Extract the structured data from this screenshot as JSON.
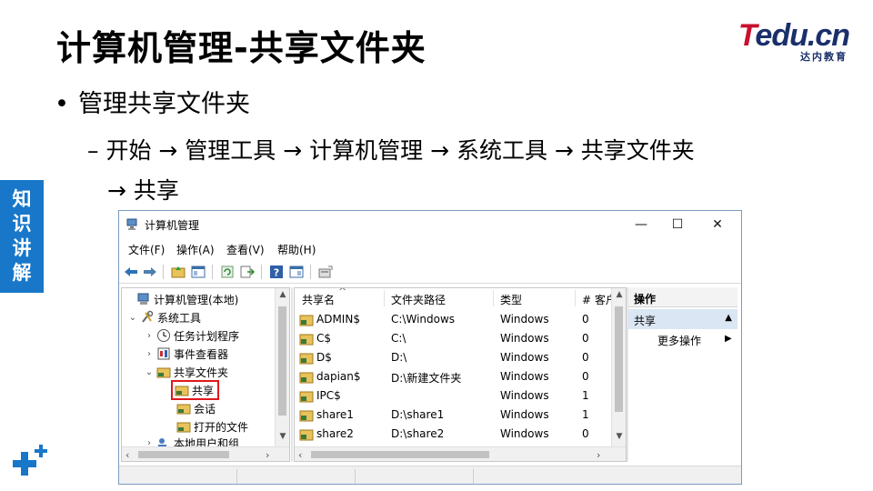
{
  "slide": {
    "title": "计算机管理-共享文件夹",
    "bullet": "管理共享文件夹",
    "path_line1": "– 开始 → 管理工具 → 计算机管理 → 系统工具 → 共享文件夹",
    "path_line2": "→ 共享",
    "side_tab": [
      "知",
      "识",
      "讲",
      "解"
    ]
  },
  "logo": {
    "brand_t": "T",
    "brand_rest": "edu.cn",
    "subtitle": "达内教育",
    "colors": {
      "red": "#c8102e",
      "navy": "#1a2f6b"
    }
  },
  "window": {
    "title": "计算机管理",
    "controls": {
      "minimize": "—",
      "maximize": "☐",
      "close": "✕"
    },
    "menu": [
      "文件(F)",
      "操作(A)",
      "查看(V)",
      "帮助(H)"
    ],
    "toolbar_icons": [
      "back-arrow-icon",
      "forward-arrow-icon",
      "up-folder-icon",
      "show-tree-icon",
      "refresh-icon",
      "export-icon",
      "help-icon",
      "properties-icon",
      "new-share-icon"
    ],
    "tree": {
      "items": [
        {
          "label": "计算机管理(本地)",
          "twisty": "",
          "icon": "computer-management-icon"
        },
        {
          "label": "系统工具",
          "twisty": "⌄",
          "icon": "system-tools-icon"
        },
        {
          "label": "任务计划程序",
          "twisty": "›",
          "icon": "task-scheduler-icon"
        },
        {
          "label": "事件查看器",
          "twisty": "›",
          "icon": "event-viewer-icon"
        },
        {
          "label": "共享文件夹",
          "twisty": "⌄",
          "icon": "shared-folders-icon"
        },
        {
          "label": "共享",
          "twisty": "",
          "icon": "shares-icon"
        },
        {
          "label": "会话",
          "twisty": "",
          "icon": "sessions-icon"
        },
        {
          "label": "打开的文件",
          "twisty": "",
          "icon": "open-files-icon"
        },
        {
          "label": "本地用户和组",
          "twisty": "›",
          "icon": "local-users-icon"
        }
      ]
    },
    "list": {
      "columns": [
        "共享名",
        "文件夹路径",
        "类型",
        "# 客户"
      ],
      "sort_glyph": "^",
      "rows": [
        {
          "name": "ADMIN$",
          "path": "C:\\Windows",
          "type": "Windows",
          "clients": "0",
          "icon": "admin-share-icon"
        },
        {
          "name": "C$",
          "path": "C:\\",
          "type": "Windows",
          "clients": "0",
          "icon": "admin-share-icon"
        },
        {
          "name": "D$",
          "path": "D:\\",
          "type": "Windows",
          "clients": "0",
          "icon": "admin-share-icon"
        },
        {
          "name": "dapian$",
          "path": "D:\\新建文件夹",
          "type": "Windows",
          "clients": "0",
          "icon": "share-folder-icon"
        },
        {
          "name": "IPC$",
          "path": "",
          "type": "Windows",
          "clients": "1",
          "icon": "share-folder-icon"
        },
        {
          "name": "share1",
          "path": "D:\\share1",
          "type": "Windows",
          "clients": "1",
          "icon": "share-folder-icon"
        },
        {
          "name": "share2",
          "path": "D:\\share2",
          "type": "Windows",
          "clients": "0",
          "icon": "share-folder-icon"
        }
      ]
    },
    "actions": {
      "header": "操作",
      "section": "共享",
      "section_arrow": "▲",
      "more": "更多操作",
      "more_arrow": "▶"
    }
  }
}
